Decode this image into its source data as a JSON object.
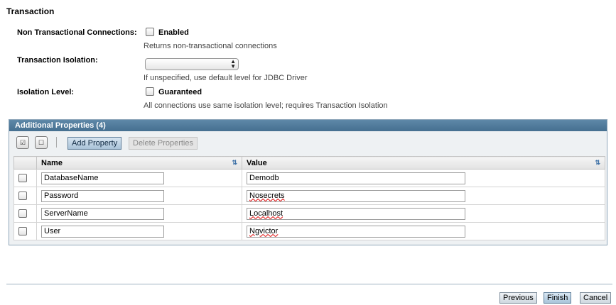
{
  "section": {
    "title": "Transaction"
  },
  "form": {
    "non_trans": {
      "label": "Non Transactional Connections:",
      "option": "Enabled",
      "help": "Returns non-transactional connections"
    },
    "isolation": {
      "label": "Transaction Isolation:",
      "value": "",
      "help": "If unspecified, use default level for JDBC Driver"
    },
    "level": {
      "label": "Isolation Level:",
      "option": "Guaranteed",
      "help": "All connections use same isolation level; requires Transaction Isolation"
    }
  },
  "panel": {
    "title": "Additional Properties (4)",
    "toolbar": {
      "select_all_icon": "select-all-icon",
      "deselect_all_icon": "deselect-all-icon",
      "add": "Add Property",
      "delete": "Delete Properties"
    },
    "columns": {
      "name": "Name",
      "value": "Value"
    },
    "rows": [
      {
        "name": "DatabaseName",
        "value": "Demodb"
      },
      {
        "name": "Password",
        "value": "Nosecrets"
      },
      {
        "name": "ServerName",
        "value": "Localhost"
      },
      {
        "name": "User",
        "value": "Ngvictor"
      }
    ]
  },
  "footer": {
    "previous": "Previous",
    "finish": "Finish",
    "cancel": "Cancel"
  }
}
